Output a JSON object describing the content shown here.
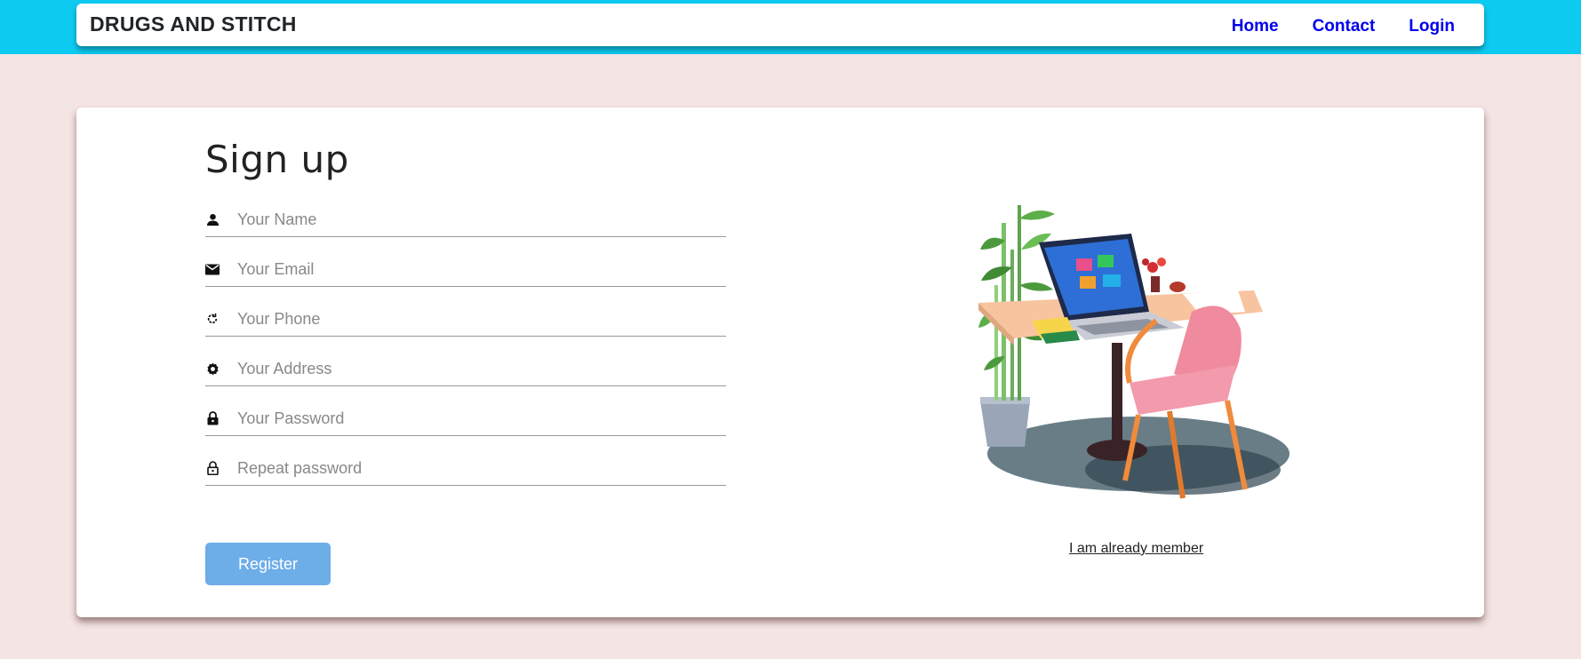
{
  "header": {
    "brand": "DRUGS AND STITCH",
    "nav": [
      {
        "label": "Home"
      },
      {
        "label": "Contact"
      },
      {
        "label": "Login"
      }
    ]
  },
  "signup": {
    "title": "Sign up",
    "fields": [
      {
        "icon": "person-icon",
        "placeholder": "Your Name",
        "value": ""
      },
      {
        "icon": "envelope-icon",
        "placeholder": "Your Email",
        "value": ""
      },
      {
        "icon": "phone-refresh-icon",
        "placeholder": "Your Phone",
        "value": ""
      },
      {
        "icon": "gear-icon",
        "placeholder": "Your Address",
        "value": ""
      },
      {
        "icon": "lock-icon",
        "placeholder": "Your Password",
        "value": ""
      },
      {
        "icon": "lock-outline-icon",
        "placeholder": "Repeat password",
        "value": ""
      }
    ],
    "register_label": "Register",
    "member_link": "I am already member",
    "illustration": "desk-laptop-chair-plant-illustration"
  },
  "colors": {
    "page_background": "#f5e4e4",
    "top_band": "#0dcaf0",
    "nav_link": "#0000ee",
    "register_button": "#6dade8"
  }
}
